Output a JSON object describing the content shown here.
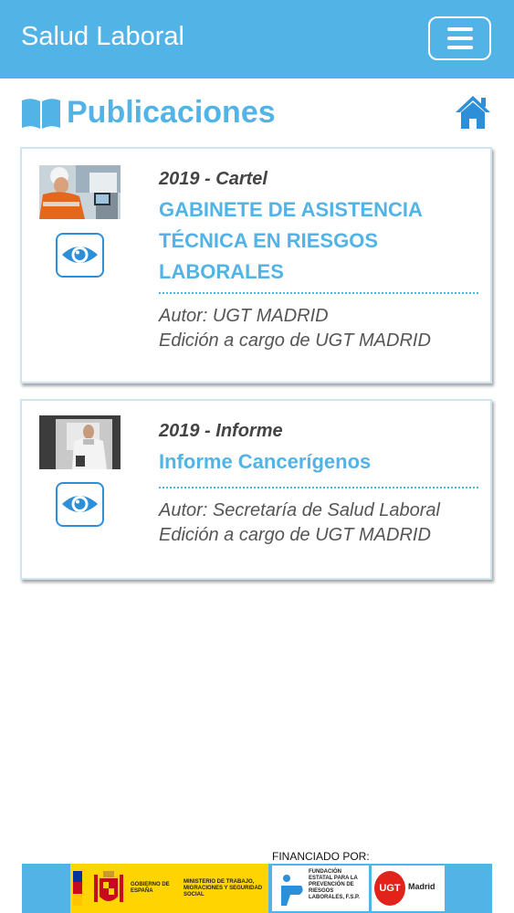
{
  "app": {
    "title": "Salud Laboral"
  },
  "header": {
    "menu_icon": "hamburger-menu-icon"
  },
  "section": {
    "title": "Publicaciones",
    "icon": "book-icon",
    "home_icon": "home-icon"
  },
  "publications": [
    {
      "meta": "2019 - Cartel",
      "title": "GABINETE DE ASISTENCIA TÉCNICA EN RIESGOS LABORALES",
      "title_lines": [
        "GABINETE DE ASISTENCIA",
        "TÉCNICA EN RIESGOS",
        "LABORALES"
      ],
      "author": "Autor: UGT MADRID",
      "edition": "Edición a cargo de UGT MADRID",
      "thumbnail": "worker-with-tablet-photo",
      "action_icon": "eye-icon"
    },
    {
      "meta": "2019 - Informe",
      "title": "Informe Cancerígenos",
      "title_lines": [
        "Informe Cancerígenos"
      ],
      "author": "Autor: Secretaría de Salud Laboral",
      "edition": "Edición a cargo de UGT MADRID",
      "thumbnail": "doctor-with-xray-photo",
      "action_icon": "eye-icon"
    }
  ],
  "footer": {
    "label": "FINANCIADO POR:",
    "gov_text": "GOBIERNO DE ESPAÑA",
    "ministry_text": "MINISTERIO DE TRABAJO, MIGRACIONES Y SEGURIDAD SOCIAL",
    "foundation_text": "FUNDACIÓN ESTATAL PARA LA PREVENCIÓN DE RIESGOS LABORALES, F.S.P.",
    "ugt_logo": "UGT",
    "ugt_region": "Madrid",
    "colors": {
      "strip": "#52b3e6",
      "gov": "#ffd400",
      "ugt": "#e2231a"
    }
  },
  "colors": {
    "primary": "#52b3e6",
    "accent": "#2d8fd8",
    "text": "#444444"
  }
}
